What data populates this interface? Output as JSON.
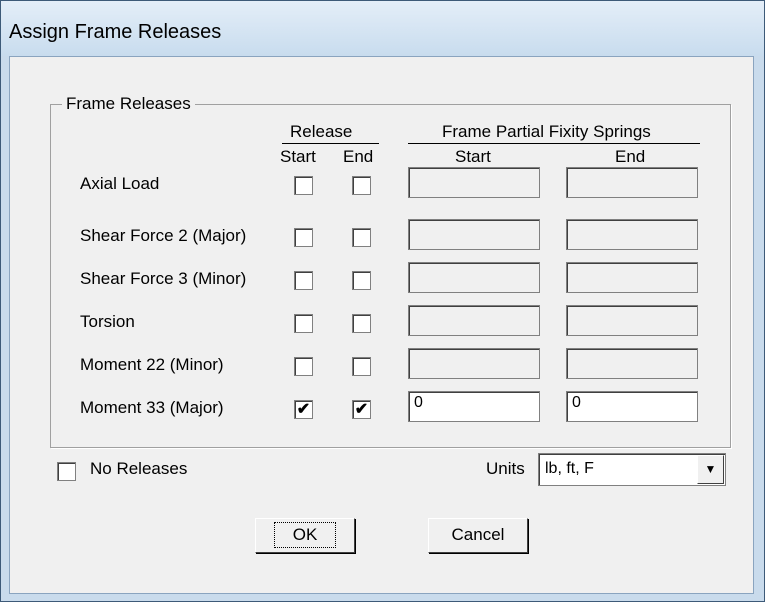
{
  "window": {
    "title": "Assign Frame Releases"
  },
  "group": {
    "caption": "Frame Releases"
  },
  "headers": {
    "release": "Release",
    "start": "Start",
    "end": "End",
    "springs": "Frame Partial Fixity Springs",
    "spring_start": "Start",
    "spring_end": "End"
  },
  "rows": [
    {
      "label": "Axial Load",
      "start_checked": false,
      "end_checked": false,
      "spring_start": "",
      "spring_end": "",
      "enabled": false
    },
    {
      "label": "Shear Force 2 (Major)",
      "start_checked": false,
      "end_checked": false,
      "spring_start": "",
      "spring_end": "",
      "enabled": false
    },
    {
      "label": "Shear Force 3 (Minor)",
      "start_checked": false,
      "end_checked": false,
      "spring_start": "",
      "spring_end": "",
      "enabled": false
    },
    {
      "label": "Torsion",
      "start_checked": false,
      "end_checked": false,
      "spring_start": "",
      "spring_end": "",
      "enabled": false
    },
    {
      "label": "Moment 22 (Minor)",
      "start_checked": false,
      "end_checked": false,
      "spring_start": "",
      "spring_end": "",
      "enabled": false
    },
    {
      "label": "Moment 33 (Major)",
      "start_checked": true,
      "end_checked": true,
      "spring_start": "0",
      "spring_end": "0",
      "enabled": true
    }
  ],
  "no_releases": {
    "label": "No Releases",
    "checked": false
  },
  "units": {
    "label": "Units",
    "value": "lb, ft, F"
  },
  "buttons": {
    "ok": "OK",
    "cancel": "Cancel"
  },
  "check_glyph": "✔"
}
